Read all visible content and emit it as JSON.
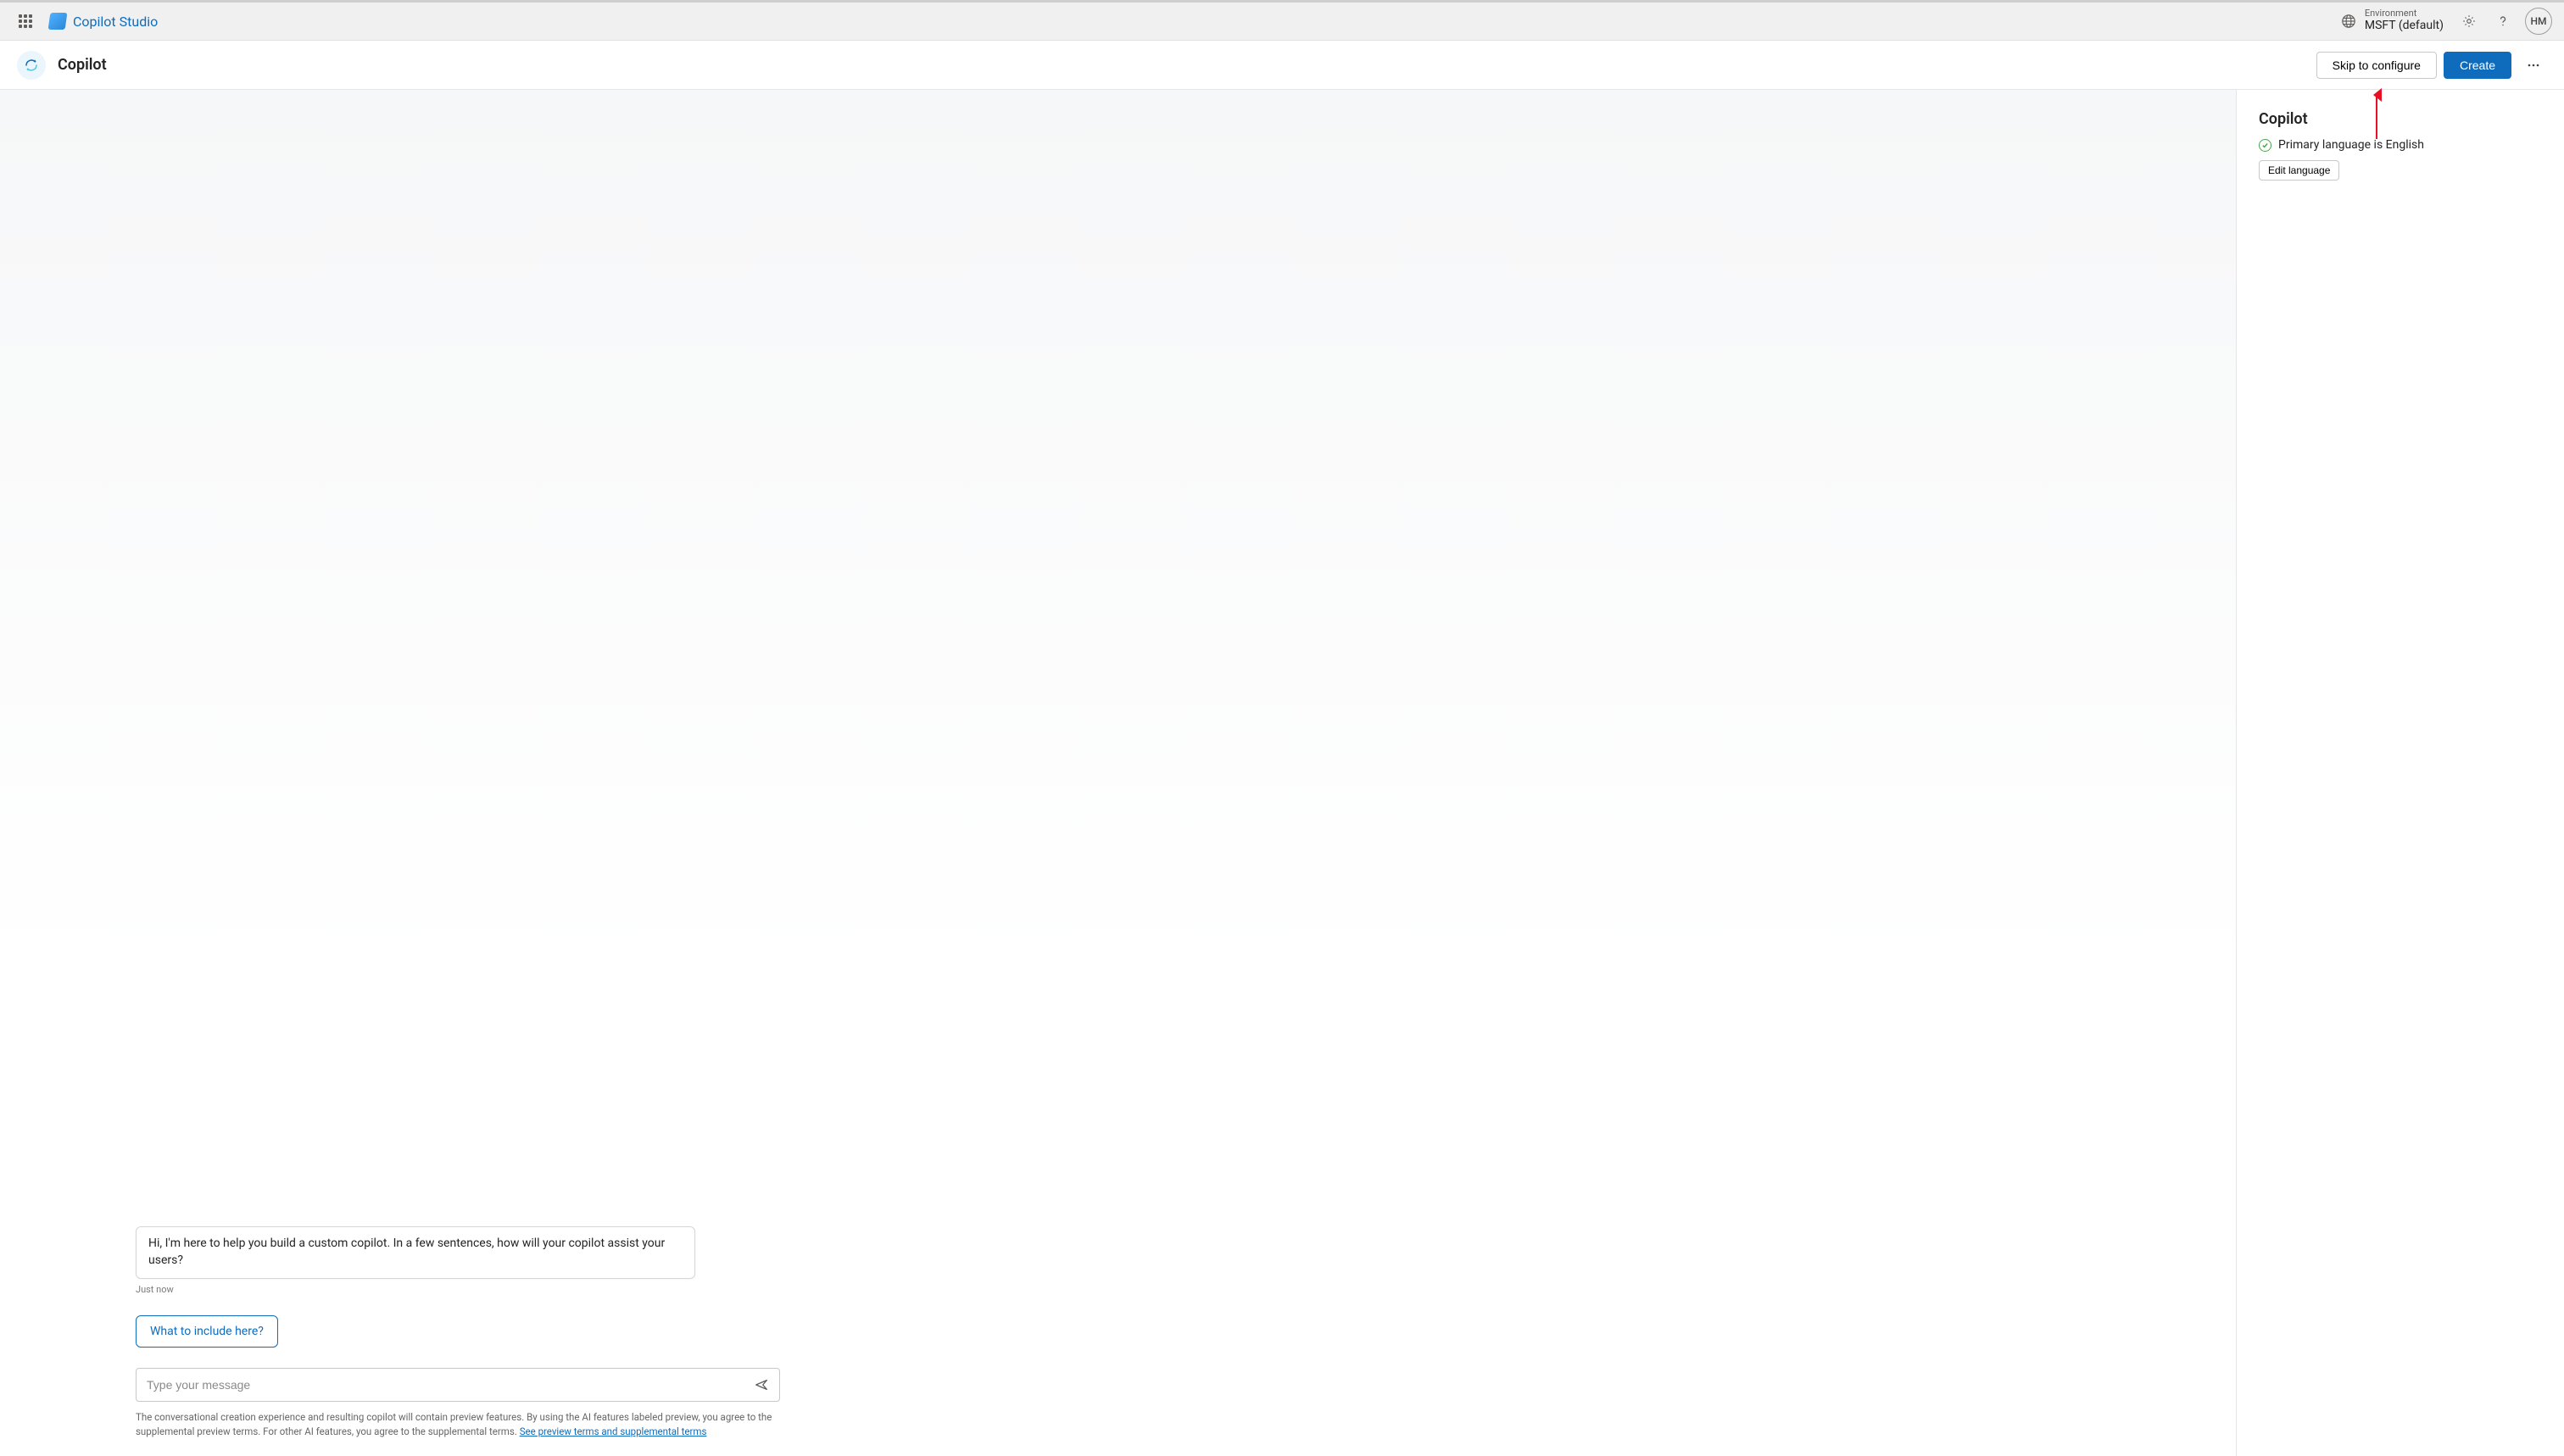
{
  "topbar": {
    "product_name": "Copilot Studio",
    "environment_label": "Environment",
    "environment_value": "MSFT (default)",
    "avatar_initials": "HM"
  },
  "cmdbar": {
    "page_title": "Copilot",
    "skip_label": "Skip to configure",
    "create_label": "Create"
  },
  "chat": {
    "welcome_message": "Hi, I'm here to help you build a custom copilot. In a few sentences, how will your copilot assist your users?",
    "timestamp": "Just now",
    "quick_reply": "What to include here?",
    "compose_placeholder": "Type your message",
    "disclaimer_text": "The conversational creation experience and resulting copilot will contain preview features. By using the AI features labeled preview, you agree to the supplemental preview terms. For other AI features, you agree to the supplemental terms. ",
    "disclaimer_link_text": "See preview terms and supplemental terms"
  },
  "side": {
    "title": "Copilot",
    "language_status": "Primary language is English",
    "edit_language_label": "Edit language"
  }
}
